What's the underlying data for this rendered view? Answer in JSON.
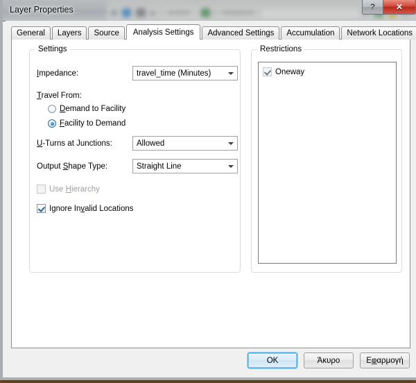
{
  "window": {
    "title": "Layer Properties",
    "help_button": "?",
    "close_button": "✕"
  },
  "tabs": [
    {
      "label": "General",
      "active": false
    },
    {
      "label": "Layers",
      "active": false
    },
    {
      "label": "Source",
      "active": false
    },
    {
      "label": "Analysis Settings",
      "active": true
    },
    {
      "label": "Advanced Settings",
      "active": false
    },
    {
      "label": "Accumulation",
      "active": false
    },
    {
      "label": "Network Locations",
      "active": false
    }
  ],
  "settings": {
    "group_label": "Settings",
    "impedance": {
      "label_prefix": "",
      "label_accel": "I",
      "label_suffix": "mpedance:",
      "value": "travel_time (Minutes)"
    },
    "travel_from": {
      "label_accel": "T",
      "label_suffix": "ravel From:",
      "options": [
        {
          "accel": "D",
          "suffix": "emand to Facility",
          "selected": false
        },
        {
          "accel": "F",
          "suffix": "acility to Demand",
          "selected": true
        }
      ]
    },
    "uturns": {
      "label_accel": "U",
      "label_suffix": "-Turns at Junctions:",
      "value": "Allowed"
    },
    "output_shape": {
      "label_prefix": "Output ",
      "label_accel": "S",
      "label_suffix": "hape Type:",
      "value": "Straight Line"
    },
    "use_hierarchy": {
      "label_prefix": "Use ",
      "label_accel": "H",
      "label_suffix": "ierarchy",
      "checked": false,
      "disabled": true
    },
    "ignore_invalid": {
      "label_prefix": "Ignore In",
      "label_accel": "v",
      "label_suffix": "alid Locations",
      "checked": true,
      "disabled": false
    }
  },
  "restrictions": {
    "group_label": "Restrictions",
    "items": [
      {
        "label": "Oneway",
        "checked": true,
        "disabled": true
      }
    ]
  },
  "buttons": {
    "ok": "OK",
    "cancel": "Άκυρο",
    "apply_prefix": "Ε",
    "apply_accel": "φ",
    "apply_suffix": "αρμογή"
  },
  "colors": {
    "accent": "#3c97d3",
    "close_red": "#d2483a",
    "dialog_bg": "#f0f0f0",
    "page_bg": "#ffffff"
  }
}
